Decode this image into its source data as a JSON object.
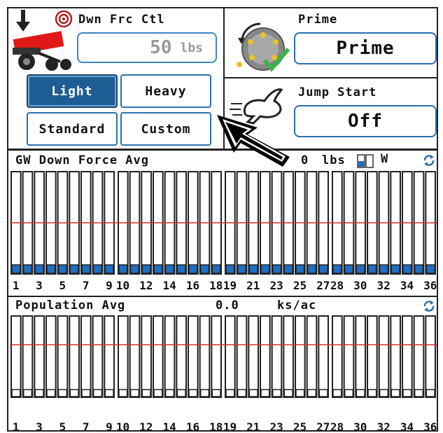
{
  "header": {
    "down_force": {
      "title": "Dwn Frc Ctl",
      "value": "50",
      "unit": "lbs"
    },
    "modes": [
      {
        "label": "Light",
        "selected": true
      },
      {
        "label": "Heavy",
        "selected": false
      },
      {
        "label": "Standard",
        "selected": false
      },
      {
        "label": "Custom",
        "selected": false
      }
    ],
    "prime": {
      "title": "Prime",
      "button": "Prime"
    },
    "jump_start": {
      "title": "Jump Start",
      "button": "Off"
    }
  },
  "down_force_panel": {
    "title": "GW Down Force Avg",
    "value": "0",
    "unit": "lbs",
    "w_label": "W",
    "row_count": 36,
    "row_labels": [
      "1",
      "3",
      "5",
      "7",
      "9",
      "10",
      "12",
      "14",
      "16",
      "18",
      "19",
      "21",
      "23",
      "25",
      "27",
      "28",
      "30",
      "32",
      "34",
      "36"
    ],
    "bar_levels": [
      0,
      0,
      0,
      0,
      0,
      0,
      0,
      0,
      0,
      0,
      0,
      0,
      0,
      0,
      0,
      0,
      0,
      0,
      0,
      0,
      0,
      0,
      0,
      0,
      0,
      0,
      0,
      0,
      0,
      0,
      0,
      0,
      0,
      0,
      0,
      0
    ]
  },
  "population_panel": {
    "title": "Population Avg",
    "value": "0.0",
    "unit": "ks/ac",
    "row_count": 36,
    "row_labels": [
      "1",
      "3",
      "5",
      "7",
      "9",
      "10",
      "12",
      "14",
      "16",
      "18",
      "19",
      "21",
      "23",
      "25",
      "27",
      "28",
      "30",
      "32",
      "34",
      "36"
    ],
    "bar_levels": [
      0,
      0,
      0,
      0,
      0,
      0,
      0,
      0,
      0,
      0,
      0,
      0,
      0,
      0,
      0,
      0,
      0,
      0,
      0,
      0,
      0,
      0,
      0,
      0,
      0,
      0,
      0,
      0,
      0,
      0,
      0,
      0,
      0,
      0,
      0,
      0
    ]
  },
  "colors": {
    "selected_button": "#1e5d93",
    "button_border": "#2a6fb0",
    "target_line": "#d03030",
    "bar_indicator": "#1e6fc4",
    "check": "#3bb34a"
  },
  "icons": [
    "down-arrow-icon",
    "target-icon",
    "planter-icon",
    "prime-meter-icon",
    "rabbit-icon",
    "refresh-icon",
    "battery-icon",
    "pointer-arrow-icon"
  ]
}
